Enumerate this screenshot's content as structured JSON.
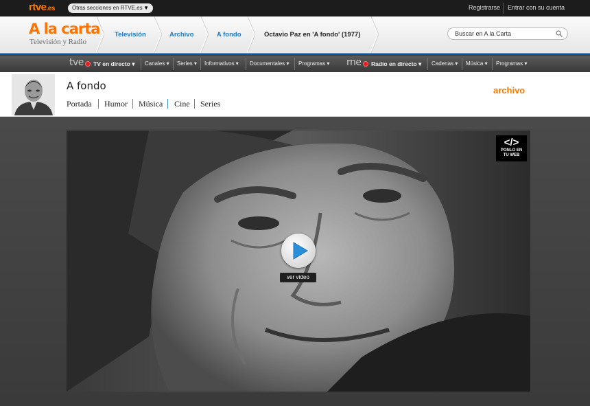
{
  "topbar": {
    "logo_main": "rtve",
    "logo_suffix": ".es",
    "sections_dropdown": "Otras secciones en RTVE.es",
    "register": "Registrarse",
    "login": "Entrar con su cuenta"
  },
  "header": {
    "title": "A la carta",
    "subtitle": "Televisión y Radio",
    "breadcrumb": [
      "Televisión",
      "Archivo",
      "A fondo",
      "Octavio Paz en 'A fondo' (1977)"
    ],
    "search_placeholder": "Buscar en A la Carta"
  },
  "navbar": {
    "tv_brand": "tve",
    "tv_live": "TV en directo ▾",
    "tv_items": [
      "Canales ▾",
      "Series ▾",
      "Informativos ▾",
      "Documentales ▾",
      "Programas ▾"
    ],
    "radio_brand": "rne",
    "radio_live": "Radio en directo ▾",
    "radio_items": [
      "Cadenas ▾",
      "Música ▾",
      "Programas ▾"
    ]
  },
  "program": {
    "title": "A fondo",
    "tabs": [
      "Portada",
      "Humor",
      "Música",
      "Cine",
      "Series"
    ],
    "section_label": "archivo"
  },
  "video": {
    "embed_code": "</>",
    "embed_line1": "PONLO EN",
    "embed_line2": "TU WEB",
    "play_label": "ver vídeo"
  },
  "colors": {
    "accent_orange": "#ff7b00",
    "link_blue": "#1a7ac8",
    "underline_blue": "#3a8ed9"
  }
}
